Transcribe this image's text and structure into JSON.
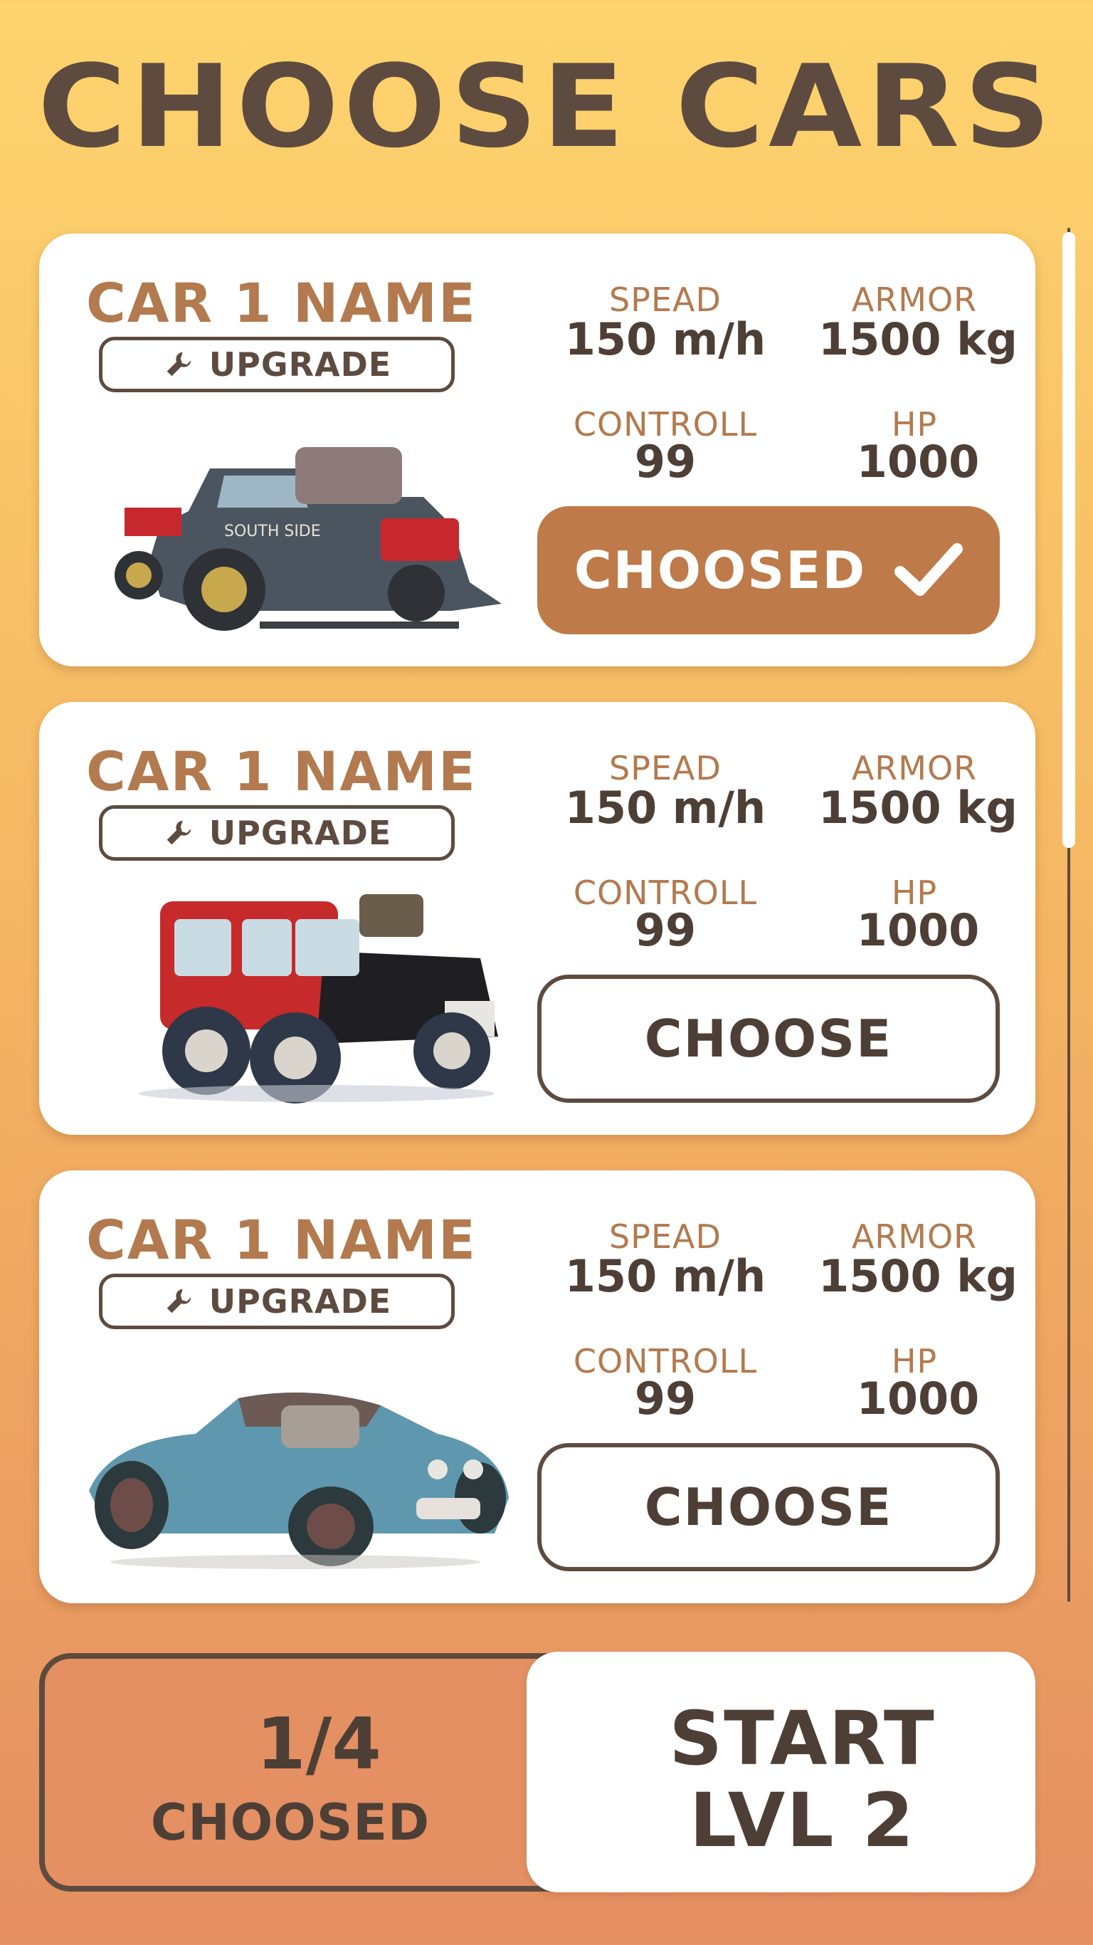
{
  "header": {
    "title": "CHOOSE CARS"
  },
  "cars": [
    {
      "name": "CAR 1 NAME",
      "upgrade_label": "UPGRADE",
      "stats": {
        "speed_label": "SPEAD",
        "speed_value": "150 m/h",
        "armor_label": "ARMOR",
        "armor_value": "1500 kg",
        "control_label": "CONTROLL",
        "control_value": "99",
        "hp_label": "HP",
        "hp_value": "1000"
      },
      "button_label": "CHOOSED",
      "selected": true,
      "body_color": "#4B5560",
      "image_icon": "tow-truck-car-icon"
    },
    {
      "name": "CAR 1 NAME",
      "upgrade_label": "UPGRADE",
      "stats": {
        "speed_label": "SPEAD",
        "speed_value": "150 m/h",
        "armor_label": "ARMOR",
        "armor_value": "1500 kg",
        "control_label": "CONTROLL",
        "control_value": "99",
        "hp_label": "HP",
        "hp_value": "1000"
      },
      "button_label": "CHOOSE",
      "selected": false,
      "body_color": "#C62A2A",
      "image_icon": "red-suv-car-icon"
    },
    {
      "name": "CAR 1 NAME",
      "upgrade_label": "UPGRADE",
      "stats": {
        "speed_label": "SPEAD",
        "speed_value": "150 m/h",
        "armor_label": "ARMOR",
        "armor_value": "1500 kg",
        "control_label": "CONTROLL",
        "control_value": "99",
        "hp_label": "HP",
        "hp_value": "1000"
      },
      "button_label": "CHOOSE",
      "selected": false,
      "body_color": "#5F98AE",
      "image_icon": "blue-hotrod-car-icon"
    }
  ],
  "footer": {
    "chosen_count": "1/4",
    "chosen_label": "CHOOSED",
    "start_line_1": "START",
    "start_line_2": "LVL 2"
  },
  "colors": {
    "background_top": "#FDD46E",
    "background_bottom": "#E48E61",
    "text_dark": "#4E3F36",
    "accent_brown": "#B27A4E",
    "selected_button": "#BE7A48",
    "card": "#FFFFFF"
  }
}
